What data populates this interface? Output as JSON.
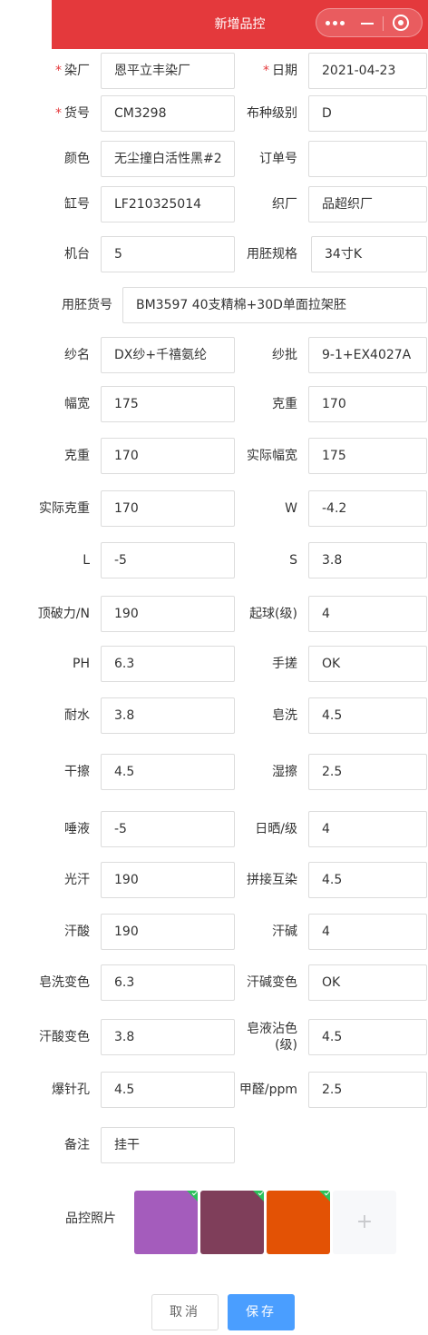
{
  "header": {
    "title": "新增品控"
  },
  "fields": [
    {
      "key": "dye_factory",
      "label": "染厂",
      "required": true,
      "value": "恩平立丰染厂"
    },
    {
      "key": "date",
      "label": "日期",
      "required": true,
      "value": "2021-04-23"
    },
    {
      "key": "item_no",
      "label": "货号",
      "required": true,
      "value": "CM3298"
    },
    {
      "key": "fabric_grade",
      "label": "布种级别",
      "required": false,
      "value": "D"
    },
    {
      "key": "color",
      "label": "颜色",
      "required": false,
      "value": "无尘撞白活性黑#2"
    },
    {
      "key": "order_no",
      "label": "订单号",
      "required": false,
      "value": ""
    },
    {
      "key": "vat_no",
      "label": "缸号",
      "required": false,
      "value": "LF210325014"
    },
    {
      "key": "weave_factory",
      "label": "织厂",
      "required": false,
      "value": "品超织厂"
    },
    {
      "key": "machine",
      "label": "机台",
      "required": false,
      "value": "5"
    },
    {
      "key": "greige_spec",
      "label": "用胚规格",
      "required": false,
      "value": "34寸K"
    },
    {
      "key": "greige_item_no",
      "label": "用胚货号",
      "required": false,
      "value": "BM3597 40支精棉+30D单面拉架胚"
    },
    {
      "key": "yarn_name",
      "label": "纱名",
      "required": false,
      "value": "DX纱+千禧氨纶"
    },
    {
      "key": "yarn_batch",
      "label": "纱批",
      "required": false,
      "value": "9-1+EX4027A"
    },
    {
      "key": "width",
      "label": "幅宽",
      "required": false,
      "value": "175"
    },
    {
      "key": "gram_weight",
      "label": "克重",
      "required": false,
      "value": "170"
    },
    {
      "key": "gram_weight_2",
      "label": "克重",
      "required": false,
      "value": "170"
    },
    {
      "key": "actual_width",
      "label": "实际幅宽",
      "required": false,
      "value": "175"
    },
    {
      "key": "actual_gram",
      "label": "实际克重",
      "required": false,
      "value": "170"
    },
    {
      "key": "w",
      "label": "W",
      "required": false,
      "value": "-4.2"
    },
    {
      "key": "l",
      "label": "L",
      "required": false,
      "value": "-5"
    },
    {
      "key": "s",
      "label": "S",
      "required": false,
      "value": "3.8"
    },
    {
      "key": "burst",
      "label": "顶破力/N",
      "required": false,
      "value": "190"
    },
    {
      "key": "pilling",
      "label": "起球(级)",
      "required": false,
      "value": "4"
    },
    {
      "key": "ph",
      "label": "PH",
      "required": false,
      "value": "6.3"
    },
    {
      "key": "hand_rub",
      "label": "手搓",
      "required": false,
      "value": "OK"
    },
    {
      "key": "water",
      "label": "耐水",
      "required": false,
      "value": "3.8"
    },
    {
      "key": "soap_wash",
      "label": "皂洗",
      "required": false,
      "value": "4.5"
    },
    {
      "key": "dry_rub",
      "label": "干擦",
      "required": false,
      "value": "4.5"
    },
    {
      "key": "wet_rub",
      "label": "湿擦",
      "required": false,
      "value": "2.5"
    },
    {
      "key": "saliva",
      "label": "唾液",
      "required": false,
      "value": "-5"
    },
    {
      "key": "sunlight",
      "label": "日晒/级",
      "required": false,
      "value": "4"
    },
    {
      "key": "light_sweat",
      "label": "光汗",
      "required": false,
      "value": "190"
    },
    {
      "key": "splice_stain",
      "label": "拼接互染",
      "required": false,
      "value": "4.5"
    },
    {
      "key": "acid_sweat",
      "label": "汗酸",
      "required": false,
      "value": "190"
    },
    {
      "key": "alkali_sweat",
      "label": "汗碱",
      "required": false,
      "value": "4"
    },
    {
      "key": "soap_color_change",
      "label": "皂洗变色",
      "required": false,
      "value": "6.3"
    },
    {
      "key": "alkali_color_change",
      "label": "汗碱变色",
      "required": false,
      "value": "OK"
    },
    {
      "key": "acid_color_change",
      "label": "汗酸变色",
      "required": false,
      "value": "3.8"
    },
    {
      "key": "soap_stain",
      "label": "皂液沾色\n(级)",
      "required": false,
      "value": "4.5"
    },
    {
      "key": "needle_hole",
      "label": "爆针孔",
      "required": false,
      "value": "4.5"
    },
    {
      "key": "formaldehyde",
      "label": "甲醛/ppm",
      "required": false,
      "value": "2.5"
    },
    {
      "key": "remark",
      "label": "备注",
      "required": false,
      "value": "挂干"
    }
  ],
  "photos": {
    "label": "品控照片",
    "items": [
      {
        "color": "#a45cbc"
      },
      {
        "color": "#7f3e5a"
      },
      {
        "color": "#e35205"
      }
    ],
    "add_icon": "+"
  },
  "buttons": {
    "cancel": "取消",
    "save": "保存"
  }
}
